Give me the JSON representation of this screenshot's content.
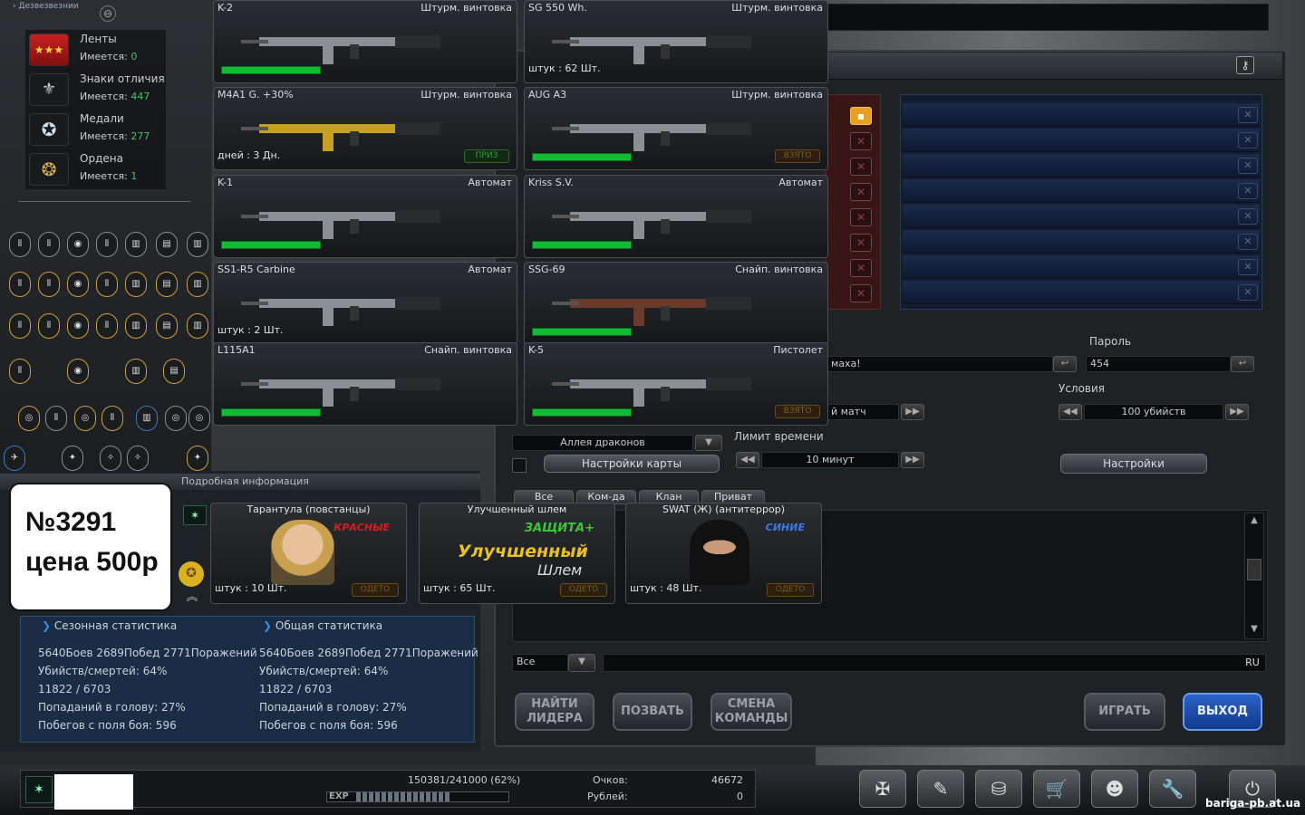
{
  "top_left_label": "Дезвезвезнии",
  "medals": [
    {
      "label": "Ленты",
      "count_label": "Имеется:",
      "count": "0",
      "icon": "ribbon-stars-icon"
    },
    {
      "label": "Знаки отличия",
      "count_label": "Имеется:",
      "count": "447",
      "icon": "insignia-icon"
    },
    {
      "label": "Медали",
      "count_label": "Имеется:",
      "count": "277",
      "icon": "medal-star-icon"
    },
    {
      "label": "Ордена",
      "count_label": "Имеется:",
      "count": "1",
      "icon": "order-icon"
    }
  ],
  "weapons": [
    {
      "name": "K-2",
      "type": "Штурм. винтовка",
      "count": "",
      "bar": true,
      "button": ""
    },
    {
      "name": "SG 550 Wh.",
      "type": "Штурм. винтовка",
      "count": "штук : 62 Шт.",
      "bar": false,
      "button": ""
    },
    {
      "name": "M4A1 G. +30%",
      "type": "Штурм. винтовка",
      "count": "дней : 3 Дн.",
      "bar": false,
      "button": "ПРИЗ"
    },
    {
      "name": "AUG A3",
      "type": "Штурм. винтовка",
      "count": "",
      "bar": true,
      "button": "ВЗЯТО"
    },
    {
      "name": "K-1",
      "type": "Автомат",
      "count": "",
      "bar": true,
      "button": ""
    },
    {
      "name": "Kriss S.V.",
      "type": "Автомат",
      "count": "",
      "bar": true,
      "button": ""
    },
    {
      "name": "SS1-R5 Carbine",
      "type": "Автомат",
      "count": "штук : 2 Шт.",
      "bar": false,
      "button": ""
    },
    {
      "name": "SSG-69",
      "type": "Снайп. винтовка",
      "count": "",
      "bar": true,
      "button": ""
    },
    {
      "name": "L115A1",
      "type": "Снайп. винтовка",
      "count": "",
      "bar": true,
      "button": ""
    },
    {
      "name": "K-5",
      "type": "Пистолет",
      "count": "",
      "bar": true,
      "button": "ВЗЯТО"
    }
  ],
  "detail": {
    "header": "Подробная информация",
    "characters": [
      {
        "name": "Тарантула (повстанцы)",
        "tag": "КРАСНЫЕ",
        "count": "штук : 10 Шт.",
        "button": "ОДЕТО"
      },
      {
        "name": "Улучшенный шлем",
        "tag": "ЗАЩИТА+",
        "title": "Улучшенный",
        "subtitle": "Шлем",
        "count": "штук : 65 Шт.",
        "button": "ОДЕТО"
      },
      {
        "name": "SWAT (Ж) (антитеррор)",
        "tag": "СИНИЕ",
        "count": "штук : 48 Шт.",
        "button": "ОДЕТО"
      }
    ]
  },
  "badge": {
    "line1": "№3291",
    "line2": "цена 500р"
  },
  "stats": {
    "season": {
      "title": "Сезонная статистика",
      "lines": [
        "5640Боев 2689Побед 2771Поражений",
        "Убийств/смертей: 64%",
        "11822 / 6703",
        "Попаданий в голову: 27%",
        "Побегов с поля боя: 596"
      ]
    },
    "total": {
      "title": "Общая статистика",
      "lines": [
        "5640Боев 2689Побед 2771Поражений",
        "Убийств/смертей: 64%",
        "11822 / 6703",
        "Попаданий в голову: 27%",
        "Побегов с поля боя: 596"
      ]
    }
  },
  "room": {
    "room_name_tail": "маха!",
    "password_label": "Пароль",
    "password_value": "454",
    "mode_tail": "й матч",
    "conditions_label": "Условия",
    "conditions_value": "100 убийств",
    "map_name": "Аллея драконов",
    "map_settings": "Настройки карты",
    "time_limit_label": "Лимит времени",
    "time_limit_value": "10 минут",
    "settings": "Настройки",
    "chat_tabs": [
      "Все",
      "Ком-да",
      "Клан",
      "Приват"
    ],
    "chat_channel": "Все",
    "chat_lang": "RU",
    "buttons": {
      "find_leader": "НАЙТИ ЛИДЕРА",
      "invite": "ПОЗВАТЬ",
      "change_team": "СМЕНА КОМАНДЫ",
      "play": "ИГРАТЬ",
      "exit": "ВЫХОД"
    }
  },
  "footer": {
    "xp_text": "150381/241000 (62%)",
    "xp_fraction": 0.62,
    "exp_label": "EXP",
    "points_label": "Очков:",
    "points_value": "46672",
    "rubles_label": "Рублей:",
    "rubles_value": "0",
    "watermark": "bariga-pb.at.ua",
    "icons": [
      "rank-emblem-icon",
      "notepad-icon",
      "inventory-bag-icon",
      "shop-cart-icon",
      "community-icon",
      "settings-wrench-icon",
      "power-icon"
    ]
  }
}
